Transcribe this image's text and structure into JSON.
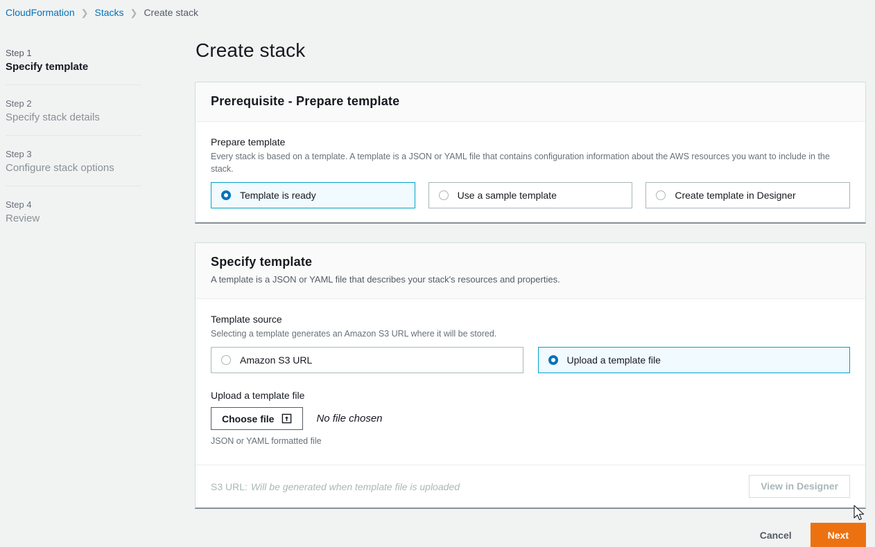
{
  "breadcrumb": {
    "items": [
      {
        "label": "CloudFormation",
        "current": false
      },
      {
        "label": "Stacks",
        "current": false
      },
      {
        "label": "Create stack",
        "current": true
      }
    ],
    "separator": "❯"
  },
  "sidebar": {
    "steps": [
      {
        "number": "Step 1",
        "name": "Specify template",
        "active": true
      },
      {
        "number": "Step 2",
        "name": "Specify stack details",
        "active": false
      },
      {
        "number": "Step 3",
        "name": "Configure stack options",
        "active": false
      },
      {
        "number": "Step 4",
        "name": "Review",
        "active": false
      }
    ]
  },
  "page": {
    "title": "Create stack"
  },
  "prerequisite_card": {
    "heading": "Prerequisite - Prepare template",
    "field_label": "Prepare template",
    "field_desc": "Every stack is based on a template. A template is a JSON or YAML file that contains configuration information about the AWS resources you want to include in the stack.",
    "options": [
      {
        "label": "Template is ready",
        "selected": true
      },
      {
        "label": "Use a sample template",
        "selected": false
      },
      {
        "label": "Create template in Designer",
        "selected": false
      }
    ]
  },
  "specify_card": {
    "heading": "Specify template",
    "desc": "A template is a JSON or YAML file that describes your stack's resources and properties.",
    "source_label": "Template source",
    "source_desc": "Selecting a template generates an Amazon S3 URL where it will be stored.",
    "source_options": [
      {
        "label": "Amazon S3 URL",
        "selected": false
      },
      {
        "label": "Upload a template file",
        "selected": true
      }
    ],
    "upload_label": "Upload a template file",
    "choose_file_label": "Choose file",
    "choose_file_icon": "upload-icon",
    "no_file_text": "No file chosen",
    "upload_hint": "JSON or YAML formatted file",
    "s3_url_label": "S3 URL:",
    "s3_url_value": "Will be generated when template file is uploaded",
    "designer_button": "View in Designer"
  },
  "actions": {
    "cancel": "Cancel",
    "next": "Next"
  },
  "colors": {
    "page_background": "#f1f3f3",
    "link": "#0073bb",
    "selected_tile_border": "#00a1c9",
    "selected_tile_background": "#f1faff",
    "radio_selected": "#0073bb",
    "primary_button": "#ec7211"
  }
}
